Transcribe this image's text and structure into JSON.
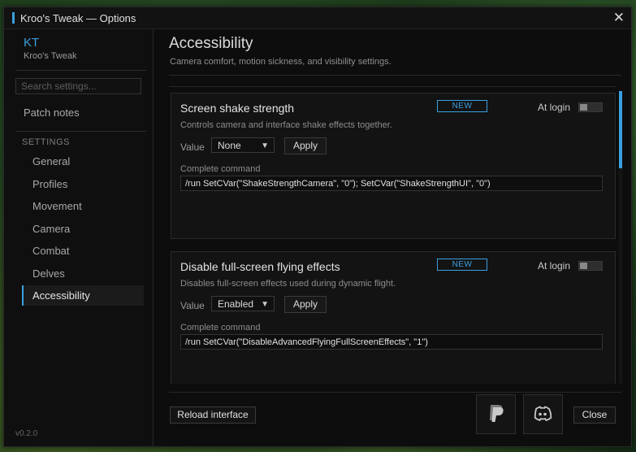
{
  "window": {
    "title": "Kroo's Tweak — Options",
    "close_glyph": "✕"
  },
  "sidebar": {
    "logo": "KT",
    "app_name": "Kroo's Tweak",
    "search_placeholder": "Search settings...",
    "patch_notes": "Patch notes",
    "section_label": "SETTINGS",
    "items": [
      {
        "label": "General"
      },
      {
        "label": "Profiles"
      },
      {
        "label": "Movement"
      },
      {
        "label": "Camera"
      },
      {
        "label": "Combat"
      },
      {
        "label": "Delves"
      },
      {
        "label": "Accessibility",
        "active": true
      }
    ],
    "version": "v0.2.0"
  },
  "main": {
    "title": "Accessibility",
    "subtitle": "Camera comfort, motion sickness, and visibility settings.",
    "cards": [
      {
        "title": "Screen shake strength",
        "description": "Controls camera and interface shake effects together.",
        "badge": "NEW",
        "at_login_label": "At login",
        "at_login_on": false,
        "value_label": "Value",
        "value": "None",
        "apply_label": "Apply",
        "command_label": "Complete command",
        "command": "/run SetCVar(\"ShakeStrengthCamera\", \"0\"); SetCVar(\"ShakeStrengthUI\", \"0\")"
      },
      {
        "title": "Disable full-screen flying effects",
        "description": "Disables full-screen effects used during dynamic flight.",
        "badge": "NEW",
        "at_login_label": "At login",
        "at_login_on": false,
        "value_label": "Value",
        "value": "Enabled",
        "apply_label": "Apply",
        "command_label": "Complete command",
        "command": "/run SetCVar(\"DisableAdvancedFlyingFullScreenEffects\", \"1\")"
      }
    ]
  },
  "footer": {
    "reload_label": "Reload interface",
    "paypal_icon": "paypal-icon",
    "discord_icon": "discord-icon",
    "close_label": "Close"
  },
  "colors": {
    "accent": "#3aa0e0",
    "background": "#0d0d0d",
    "text": "#c9c9c9"
  }
}
